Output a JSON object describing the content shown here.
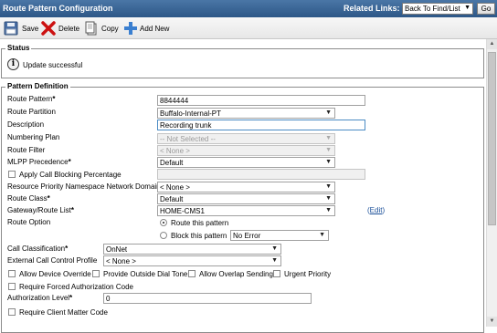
{
  "title": "Route Pattern Configuration",
  "related_links": {
    "label": "Related Links:",
    "selected": "Back To Find/List",
    "go": "Go"
  },
  "toolbar": {
    "save": "Save",
    "delete": "Delete",
    "copy": "Copy",
    "add_new": "Add New"
  },
  "status": {
    "legend": "Status",
    "message": "Update successful"
  },
  "pattern": {
    "legend": "Pattern Definition",
    "route_pattern": {
      "label": "Route Pattern",
      "value": "8844444"
    },
    "route_partition": {
      "label": "Route Partition",
      "value": "Buffalo-Internal-PT"
    },
    "description": {
      "label": "Description",
      "value": "Recording trunk"
    },
    "numbering_plan": {
      "label": "Numbering Plan",
      "value": "-- Not Selected --"
    },
    "route_filter": {
      "label": "Route Filter",
      "value": "< None >"
    },
    "mlpp_precedence": {
      "label": "MLPP Precedence",
      "value": "Default"
    },
    "apply_call_blocking": {
      "label": "Apply Call Blocking Percentage",
      "checked": false
    },
    "rpn_domain": {
      "label": "Resource Priority Namespace Network Domain",
      "value": "< None >"
    },
    "route_class": {
      "label": "Route Class",
      "value": "Default"
    },
    "gateway_route_list": {
      "label": "Gateway/Route List",
      "value": "HOME-CMS1",
      "edit_link": "Edit"
    },
    "route_option": {
      "label": "Route Option",
      "route": "Route this pattern",
      "block": "Block this pattern",
      "block_reason": "No Error",
      "selected": "route"
    },
    "call_classification": {
      "label": "Call Classification",
      "value": "OnNet"
    },
    "external_call_control": {
      "label": "External Call Control Profile",
      "value": "< None >"
    },
    "allow_device_override": {
      "label": "Allow Device Override",
      "checked": false
    },
    "provide_outside_dial_tone": {
      "label": "Provide Outside Dial Tone",
      "checked": false
    },
    "allow_overlap_sending": {
      "label": "Allow Overlap Sending",
      "checked": false
    },
    "urgent_priority": {
      "label": "Urgent Priority",
      "checked": false
    },
    "require_fac": {
      "label": "Require Forced Authorization Code",
      "checked": false
    },
    "authorization_level": {
      "label": "Authorization Level",
      "value": "0"
    },
    "require_cmc": {
      "label": "Require Client Matter Code",
      "checked": false
    }
  },
  "required_marker": "*",
  "colors": {
    "title_bar": "#3b67a0",
    "link": "#1a4f99"
  }
}
